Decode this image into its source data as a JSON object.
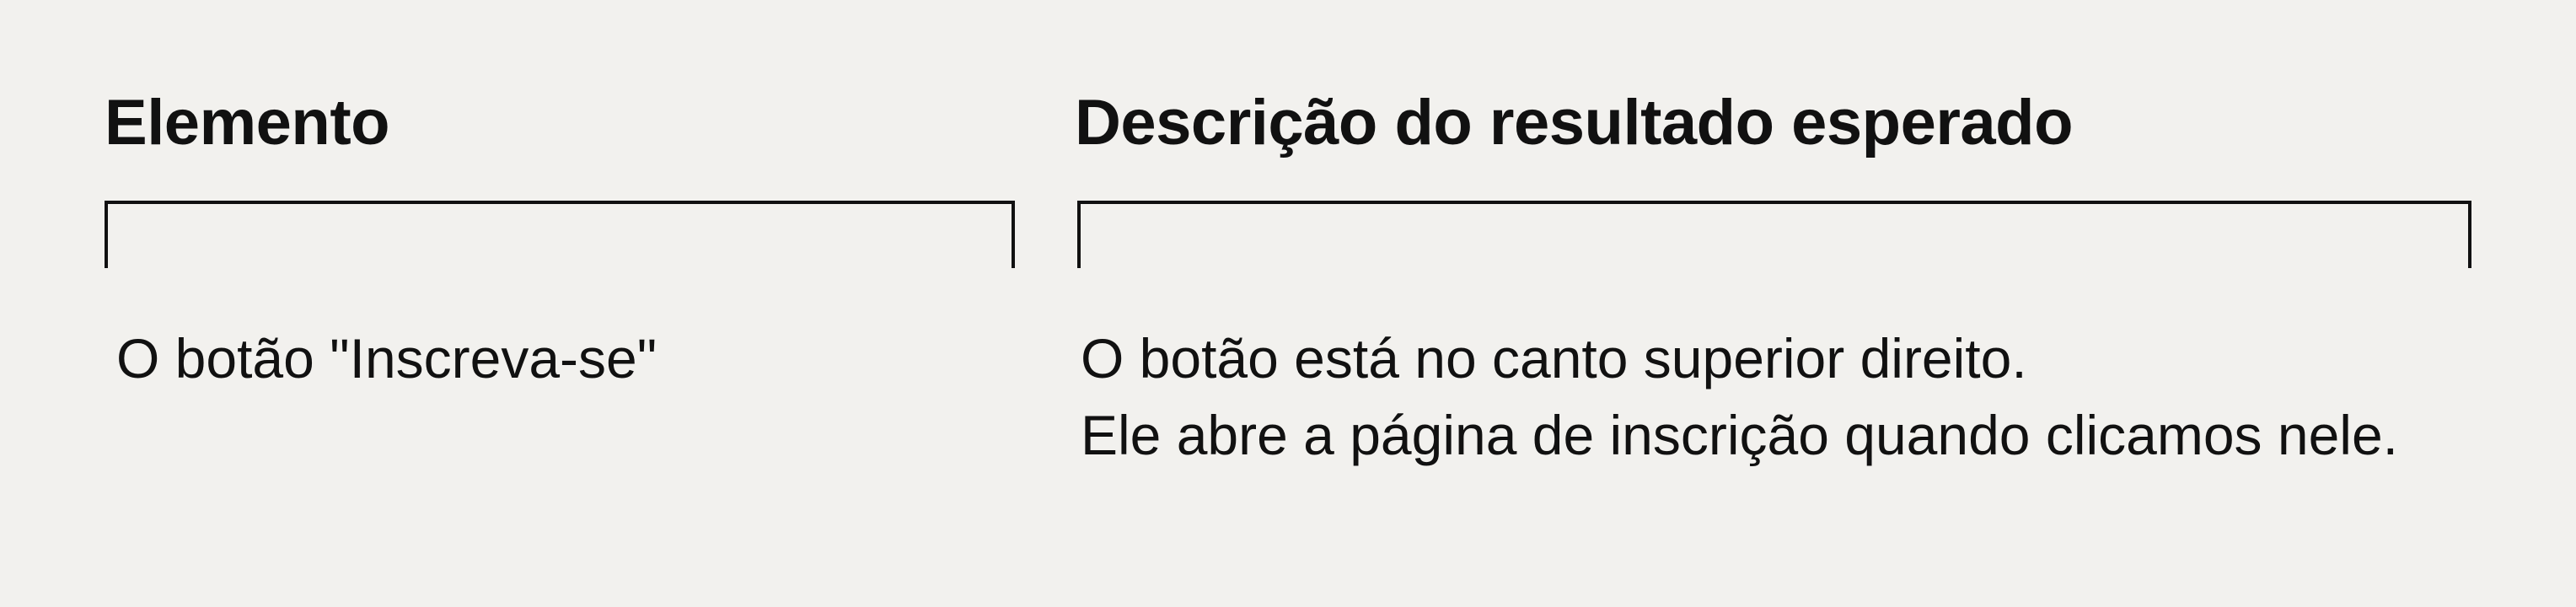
{
  "columns": [
    {
      "header": "Elemento",
      "lines": [
        "O botão \"Inscreva-se\""
      ]
    },
    {
      "header": "Descrição do resultado esperado",
      "lines": [
        "O botão está no canto superior direito.",
        "Ele abre a página de inscrição quando clicamos nele."
      ]
    }
  ]
}
